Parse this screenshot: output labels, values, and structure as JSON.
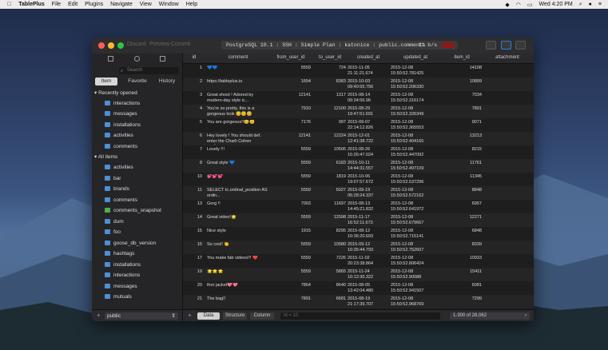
{
  "menubar": {
    "apple": "",
    "app_name": "TablePlus",
    "items": [
      "File",
      "Edit",
      "Plugins",
      "Navigate",
      "View",
      "Window",
      "Help"
    ],
    "clock": "Wed 4:20 PM"
  },
  "toolbar": {
    "disabled": [
      "Discard",
      "Preview",
      "Commit"
    ],
    "connection": "PostgreSQL 10.1 : SSH : Simple Plan : katonice : public.comments",
    "rate": "11 b/s"
  },
  "sidebar": {
    "search_placeholder": "Search",
    "tabs": [
      "Item",
      "Favorite",
      "History"
    ],
    "recent_title": "Recently opened",
    "recent": [
      "interactions",
      "messages",
      "installations",
      "activities",
      "comments"
    ],
    "all_title": "All items",
    "all": [
      "activities",
      "bar",
      "brands",
      "comments",
      "comments_snapshot",
      "dum",
      "foo",
      "goose_db_version",
      "hashtags",
      "installations",
      "interactions",
      "messages",
      "mutuals"
    ],
    "schema": "public"
  },
  "grid": {
    "columns": [
      "id",
      "comment",
      "from_user_id",
      "to_user_id",
      "created_at",
      "updated_at",
      "item_id",
      "attachment"
    ],
    "rows": [
      {
        "id": "1",
        "comment": "💙💙",
        "from": "5559",
        "to": "724",
        "created": "2015-11-05 21:11:21.674",
        "updated": "2015-12-08 15:50:52.781425",
        "item": "14108",
        "attach": ""
      },
      {
        "id": "2",
        "comment": "https://tableplus.io",
        "from": "1654",
        "to": "8383",
        "created": "2015-10-03 09:40:55.756",
        "updated": "2015-12-08 15:50:52.206330",
        "item": "10899",
        "attach": ""
      },
      {
        "id": "3",
        "comment": "Great shoot ! Adored by modern-day style ic...",
        "from": "12141",
        "to": "1317",
        "created": "2015-08-14 09:34:56.96",
        "updated": "2015-12-08 15:50:52.316174",
        "item": "7034",
        "attach": ""
      },
      {
        "id": "4",
        "comment": "You're so pretty, this is a gorgeous look 😊😊😊",
        "from": "7910",
        "to": "12100",
        "created": "2015-08-29 19:47:51.691",
        "updated": "2015-12-08 15:50:52.326349",
        "item": "7891",
        "attach": ""
      },
      {
        "id": "5",
        "comment": "You are gorgeous!!😊😊",
        "from": "7176",
        "to": "997",
        "created": "2015-09-07 22:14:12.826",
        "updated": "2015-12-08 15:50:52.365553",
        "item": "9071",
        "attach": ""
      },
      {
        "id": "6",
        "comment": "Hey lovely ! You should def. enter the Charli Cohen casting...",
        "from": "12141",
        "to": "12224",
        "created": "2015-12-01 12:41:38.722",
        "updated": "2015-12-08 15:50:52.404165",
        "item": "13213",
        "attach": ""
      },
      {
        "id": "7",
        "comment": "Lovely !!!",
        "from": "5559",
        "to": "10506",
        "created": "2015-08-26 15:26:47.024",
        "updated": "2015-12-08 15:50:52.447092",
        "item": "8215",
        "attach": ""
      },
      {
        "id": "8",
        "comment": "Great style 💙",
        "from": "5559",
        "to": "6183",
        "created": "2015-10-11 14:44:31.557",
        "updated": "2015-12-08 15:50:52.497109",
        "item": "11761",
        "attach": ""
      },
      {
        "id": "10",
        "comment": "💕💕💕",
        "from": "5559",
        "to": "1819",
        "created": "2015-10-06 19:07:57.672",
        "updated": "2015-12-08 15:50:52.537296",
        "item": "11345",
        "attach": ""
      },
      {
        "id": "11",
        "comment": "SELECT tc.ordinal_position AS ordin...",
        "from": "5559",
        "to": "6027",
        "created": "2015-09-19 05:28:24.337",
        "updated": "2015-12-08 15:50:52.572162",
        "item": "8848",
        "attach": ""
      },
      {
        "id": "13",
        "comment": "Gorg !!",
        "from": "7003",
        "to": "11697",
        "created": "2015-08-13 14:45:21.832",
        "updated": "2015-12-08 15:50:52.641972",
        "item": "6957",
        "attach": ""
      },
      {
        "id": "14",
        "comment": "Great video!🌟",
        "from": "5559",
        "to": "12598",
        "created": "2015-11-17 16:52:11.673",
        "updated": "2015-12-08 15:50:52.679667",
        "item": "12271",
        "attach": ""
      },
      {
        "id": "15",
        "comment": "Nice style",
        "from": "1915",
        "to": "8295",
        "created": "2015-08-12 10:36:20.693",
        "updated": "2015-12-08 15:50:52.715141",
        "item": "6848",
        "attach": ""
      },
      {
        "id": "16",
        "comment": "So cool! 👏",
        "from": "5559",
        "to": "10580",
        "created": "2015-09-12 10:35:44.793",
        "updated": "2015-12-08 15:50:52.752607",
        "item": "8339",
        "attach": ""
      },
      {
        "id": "17",
        "comment": "You make fab videos!!! ❤️",
        "from": "5559",
        "to": "7226",
        "created": "2015-11-02 20:23:38.864",
        "updated": "2015-12-08 15:50:52.806424",
        "item": "10933",
        "attach": ""
      },
      {
        "id": "19",
        "comment": "🌟🌟🌟",
        "from": "5559",
        "to": "5865",
        "created": "2015-11-24 10:12:30.322",
        "updated": "2015-12-08 15:50:52.90088",
        "item": "15411",
        "attach": ""
      },
      {
        "id": "20",
        "comment": "thor jacket💖💖",
        "from": "7864",
        "to": "8640",
        "created": "2015-08-05 13:42:04.480",
        "updated": "2015-12-08 15:50:52.941507",
        "item": "6081",
        "attach": ""
      },
      {
        "id": "21",
        "comment": "The bag!!",
        "from": "7891",
        "to": "6681",
        "created": "2015-08-19 21:17:39.707",
        "updated": "2015-12-08 15:50:52.968769",
        "item": "7299",
        "attach": ""
      }
    ]
  },
  "bottom": {
    "tabs": [
      "Data",
      "Structure",
      "Column"
    ],
    "filter_placeholder": "id = 10",
    "page": "1-300 of 28,062"
  }
}
